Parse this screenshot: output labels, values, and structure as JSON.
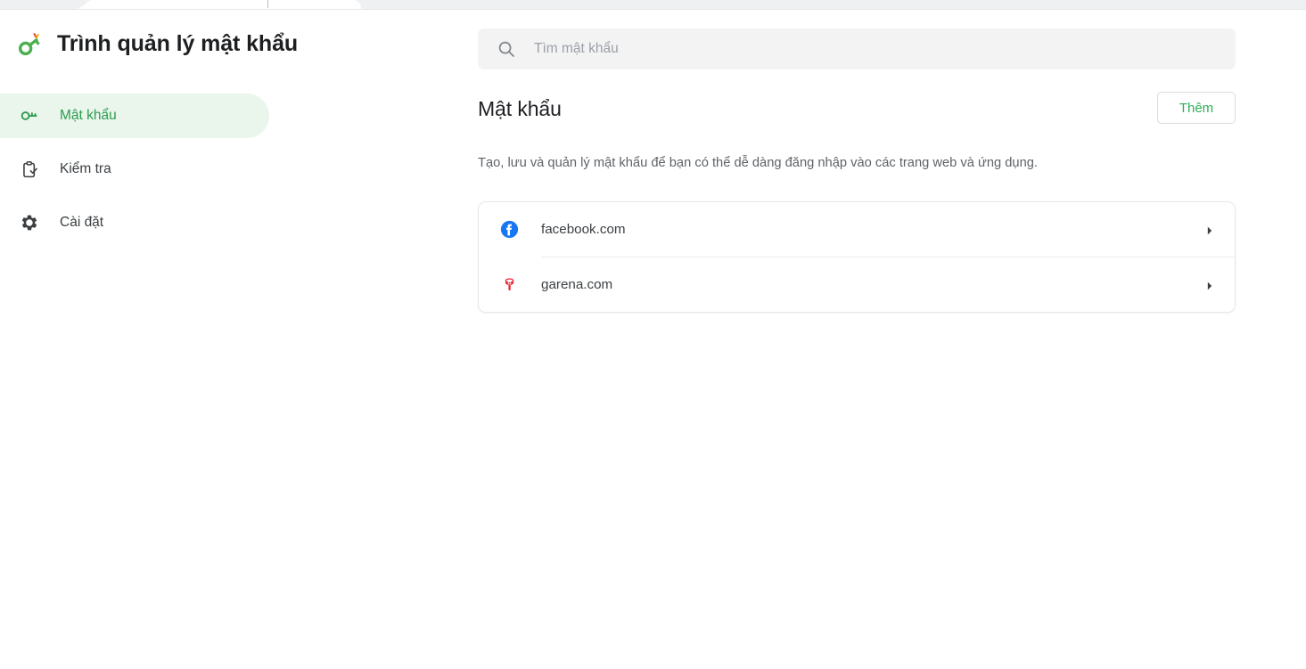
{
  "browser": {
    "tab_title": ""
  },
  "header": {
    "logo_icon": "key-icon",
    "title": "Trình quản lý mật khẩu",
    "search": {
      "icon": "search-icon",
      "placeholder": "Tìm mật khẩu",
      "value": ""
    }
  },
  "sidebar": {
    "items": [
      {
        "label": "Mật khẩu",
        "icon": "key-icon",
        "active": true
      },
      {
        "label": "Kiểm tra",
        "icon": "clipboard-check-icon",
        "active": false
      },
      {
        "label": "Cài đặt",
        "icon": "gear-icon",
        "active": false
      }
    ]
  },
  "main": {
    "title": "Mật khẩu",
    "add_label": "Thêm",
    "description": "Tạo, lưu và quản lý mật khẩu để bạn có thể dễ dàng đăng nhập vào các trang web và ứng dụng.",
    "entries": [
      {
        "site": "facebook.com",
        "favicon": "facebook-icon",
        "chevron": "chevron-right-icon"
      },
      {
        "site": "garena.com",
        "favicon": "garena-icon",
        "chevron": "chevron-right-icon"
      }
    ]
  },
  "colors": {
    "accent_green": "#2a9d4e",
    "button_green": "#2eaf57",
    "active_bg": "#eaf5ec",
    "facebook_blue": "#1877F2",
    "garena_red": "#EE2737",
    "text_primary": "#3c4043",
    "text_secondary": "#5f6368",
    "placeholder": "#9aa0a6"
  }
}
